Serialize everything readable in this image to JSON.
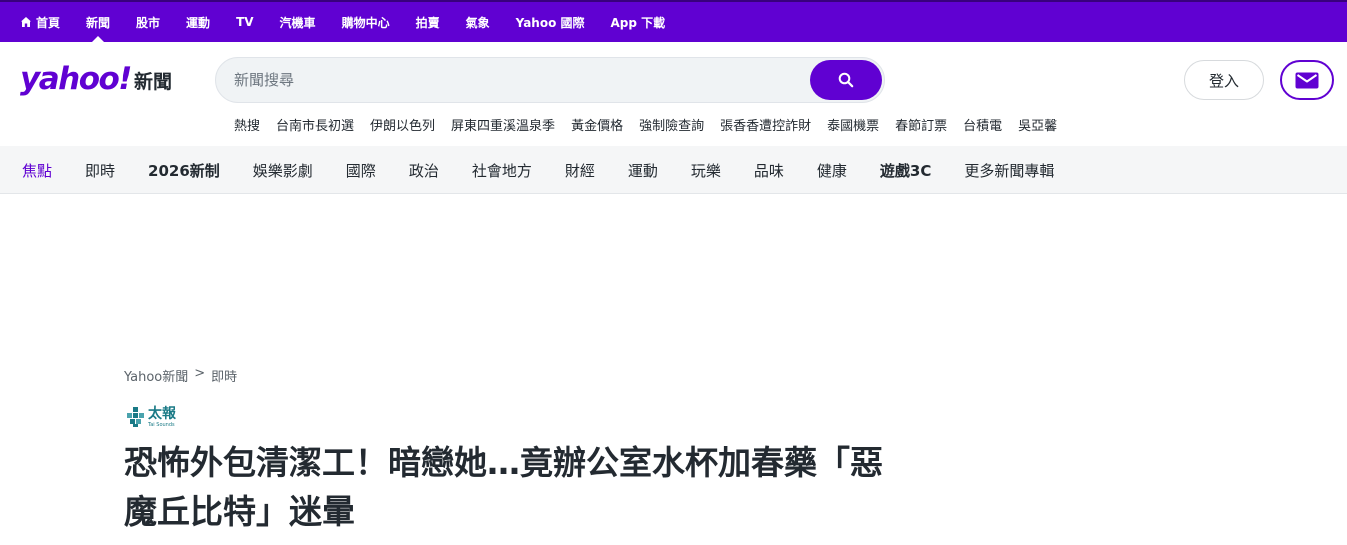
{
  "topnav": {
    "items": [
      {
        "label": "首頁",
        "icon": "home-icon"
      },
      {
        "label": "新聞",
        "active": true
      },
      {
        "label": "股市"
      },
      {
        "label": "運動"
      },
      {
        "label": "TV"
      },
      {
        "label": "汽機車"
      },
      {
        "label": "購物中心"
      },
      {
        "label": "拍賣"
      },
      {
        "label": "氣象"
      },
      {
        "label": "Yahoo 國際"
      },
      {
        "label": "App 下載"
      }
    ]
  },
  "header": {
    "logo_word": "yahoo!",
    "logo_section": "新聞",
    "search_placeholder": "新聞搜尋",
    "signin_label": "登入",
    "trending": [
      "熱搜",
      "台南市長初選",
      "伊朗以色列",
      "屏東四重溪溫泉季",
      "黃金價格",
      "強制險查詢",
      "張香香遭控詐財",
      "泰國機票",
      "春節訂票",
      "台積電",
      "吳亞馨"
    ]
  },
  "catnav": {
    "items": [
      {
        "label": "焦點",
        "active": true
      },
      {
        "label": "即時"
      },
      {
        "label": "2026新制",
        "bold": true
      },
      {
        "label": "娛樂影劇"
      },
      {
        "label": "國際"
      },
      {
        "label": "政治"
      },
      {
        "label": "社會地方"
      },
      {
        "label": "財經"
      },
      {
        "label": "運動"
      },
      {
        "label": "玩樂"
      },
      {
        "label": "品味"
      },
      {
        "label": "健康"
      },
      {
        "label": "遊戲3C",
        "bold": true
      },
      {
        "label": "更多新聞專輯"
      }
    ]
  },
  "article": {
    "breadcrumb": [
      "Yahoo新聞",
      ">",
      "即時"
    ],
    "source": {
      "name": "太報",
      "sub": "Tai Sounds"
    },
    "headline": "恐怖外包清潔工！暗戀她…竟辦公室水杯加春藥「惡魔丘比特」迷暈"
  },
  "colors": {
    "brand": "#6001d2",
    "text": "#232a31",
    "source": "#1a7a86"
  }
}
